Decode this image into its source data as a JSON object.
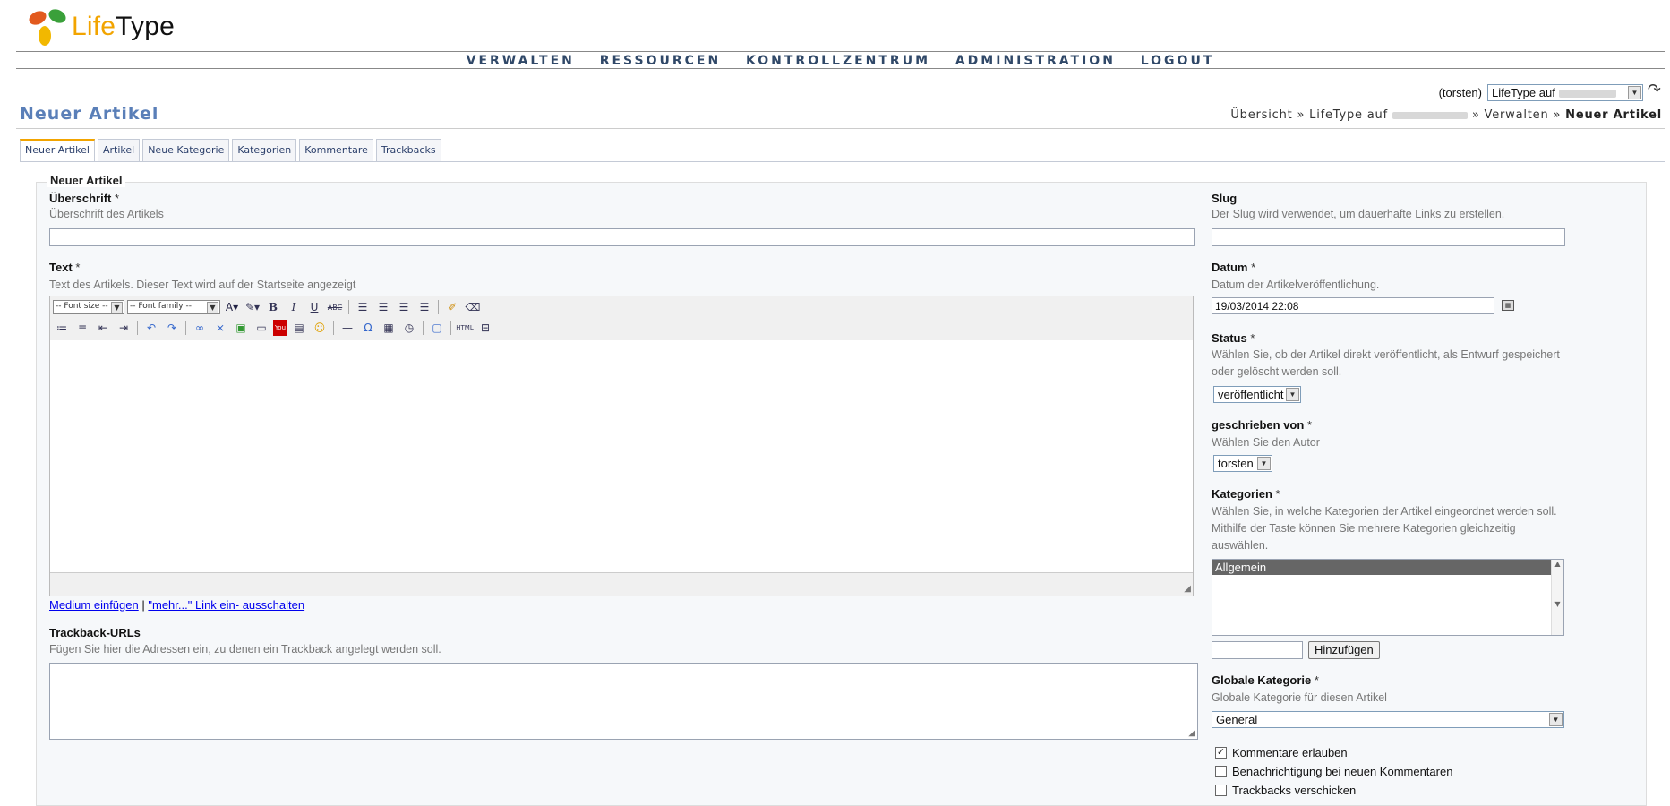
{
  "logo": {
    "life": "Life",
    "type": "Type"
  },
  "nav": [
    "VERWALTEN",
    "RESSOURCEN",
    "KONTROLLZENTRUM",
    "ADMINISTRATION",
    "LOGOUT"
  ],
  "blogselector": {
    "user": "(torsten)",
    "value": "LifeType auf"
  },
  "page": {
    "title": "Neuer Artikel"
  },
  "breadcrumb": {
    "overview": "Übersicht",
    "sep": "»",
    "blog": "LifeType auf",
    "manage": "Verwalten",
    "current": "Neuer Artikel"
  },
  "tabs": [
    "Neuer Artikel",
    "Artikel",
    "Neue Kategorie",
    "Kategorien",
    "Kommentare",
    "Trackbacks"
  ],
  "form": {
    "legend": "Neuer Artikel",
    "heading": {
      "label": "Überschrift",
      "required": "*",
      "hint": "Überschrift des Artikels",
      "value": ""
    },
    "text": {
      "label": "Text",
      "required": "*",
      "hint": "Text des Artikels. Dieser Text wird auf der Startseite angezeigt"
    },
    "editor": {
      "fontsize": "-- Font size --",
      "fontfamily": "-- Font family --"
    },
    "links": {
      "media": "Medium einfügen",
      "sep": "|",
      "more": "\"mehr...\" Link ein- ausschalten"
    },
    "trackback": {
      "label": "Trackback-URLs",
      "hint": "Fügen Sie hier die Adressen ein, zu denen ein Trackback angelegt werden soll."
    },
    "slug": {
      "label": "Slug",
      "hint": "Der Slug wird verwendet, um dauerhafte Links zu erstellen.",
      "value": ""
    },
    "date": {
      "label": "Datum",
      "required": "*",
      "hint": "Datum der Artikelveröffentlichung.",
      "value": "19/03/2014 22:08"
    },
    "status": {
      "label": "Status",
      "required": "*",
      "hint": "Wählen Sie, ob der Artikel direkt veröffentlicht, als Entwurf gespeichert oder gelöscht werden soll.",
      "value": "veröffentlicht"
    },
    "author": {
      "label": "geschrieben von",
      "required": "*",
      "hint": "Wählen Sie den Autor",
      "value": "torsten"
    },
    "categories": {
      "label": "Kategorien",
      "required": "*",
      "hint": "Wählen Sie, in welche Kategorien der Artikel eingeordnet werden soll. Mithilfe der Taste können Sie mehrere Kategorien gleichzeitig auswählen.",
      "options": [
        "Allgemein"
      ],
      "add_button": "Hinzufügen",
      "new_value": ""
    },
    "global_category": {
      "label": "Globale Kategorie",
      "required": "*",
      "hint": "Globale Kategorie für diesen Artikel",
      "value": "General"
    },
    "checks": {
      "comments": "Kommentare erlauben",
      "notify": "Benachrichtigung bei neuen Kommentaren",
      "trackbacks": "Trackbacks verschicken",
      "comments_checked": true
    }
  }
}
